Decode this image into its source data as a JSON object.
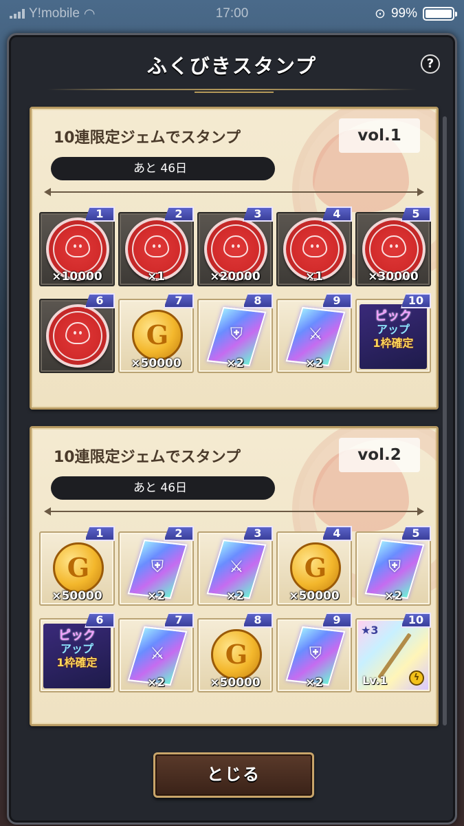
{
  "status_bar": {
    "carrier": "Y!mobile",
    "time": "17:00",
    "battery_percent": "99%",
    "battery_level": 0.99
  },
  "dialog": {
    "title": "ふくびきスタンプ",
    "help_label": "?",
    "close_label": "とじる"
  },
  "cards": [
    {
      "title": "10連限定ジェムでスタンプ",
      "vol": "vol.1",
      "remaining": "あと 46日",
      "slots": [
        {
          "num": "1",
          "type": "stamped",
          "qty": "×10000"
        },
        {
          "num": "2",
          "type": "stamped",
          "qty": "×1"
        },
        {
          "num": "3",
          "type": "stamped",
          "qty": "×20000"
        },
        {
          "num": "4",
          "type": "stamped",
          "qty": "×1"
        },
        {
          "num": "5",
          "type": "stamped",
          "qty": "×30000"
        },
        {
          "num": "6",
          "type": "stamped",
          "qty": ""
        },
        {
          "num": "7",
          "type": "coin",
          "qty": "×50000"
        },
        {
          "num": "8",
          "type": "shield-crystal",
          "qty": "×2"
        },
        {
          "num": "9",
          "type": "sword-crystal",
          "qty": "×2"
        },
        {
          "num": "10",
          "type": "pickup",
          "qty": ""
        }
      ]
    },
    {
      "title": "10連限定ジェムでスタンプ",
      "vol": "vol.2",
      "remaining": "あと 46日",
      "slots": [
        {
          "num": "1",
          "type": "coin",
          "qty": "×50000"
        },
        {
          "num": "2",
          "type": "shield-crystal",
          "qty": "×2"
        },
        {
          "num": "3",
          "type": "sword-crystal",
          "qty": "×2"
        },
        {
          "num": "4",
          "type": "coin",
          "qty": "×50000"
        },
        {
          "num": "5",
          "type": "shield-crystal",
          "qty": "×2"
        },
        {
          "num": "6",
          "type": "pickup",
          "qty": ""
        },
        {
          "num": "7",
          "type": "sword-crystal",
          "qty": "×2"
        },
        {
          "num": "8",
          "type": "coin",
          "qty": "×50000"
        },
        {
          "num": "9",
          "type": "shield-crystal",
          "qty": "×2"
        },
        {
          "num": "10",
          "type": "weapon",
          "qty": ""
        }
      ]
    }
  ],
  "pickup_ticket": {
    "line1": "ピック",
    "line2": "アップ",
    "line3": "1枠確定"
  },
  "coin_letter": "G",
  "weapon_card": {
    "star": "★3",
    "level": "Lv.1",
    "element_icon": "lightning-icon"
  },
  "colors": {
    "slot_number_badge": "#3a3fa0",
    "stamp_red": "#d12a2a",
    "coin_gold": "#f3b72c",
    "panel_bg": "#24272e",
    "card_bg": "#f4ead1"
  }
}
